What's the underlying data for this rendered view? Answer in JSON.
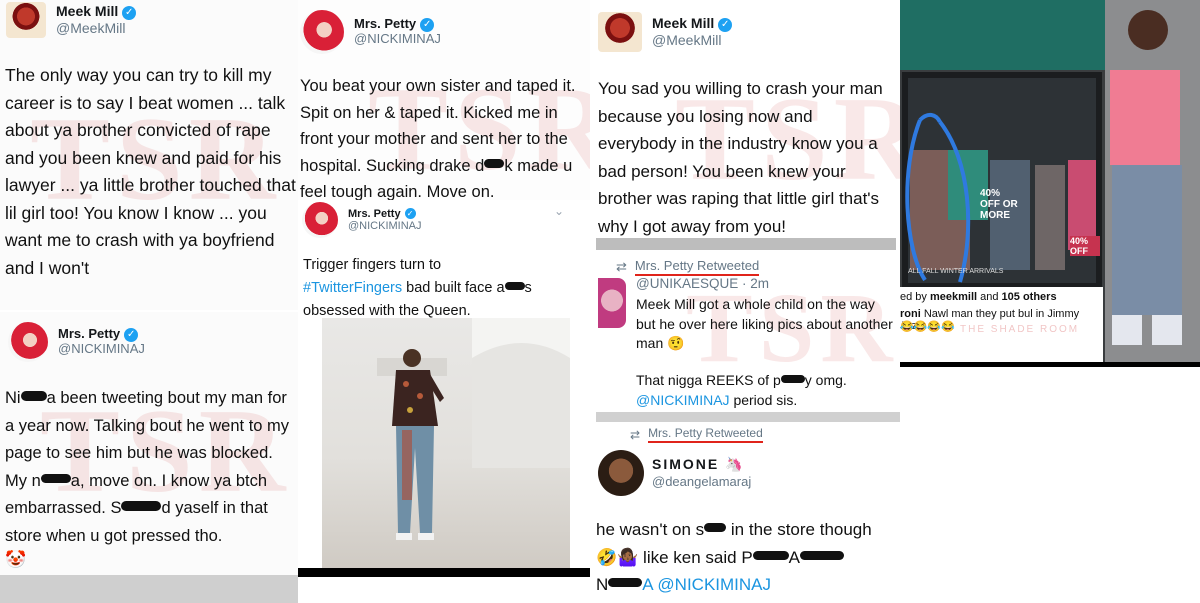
{
  "tweets": {
    "t1": {
      "name": "Meek Mill",
      "handle": "@MeekMill",
      "text": "The only way you can try to kill my career is to say I beat women ... talk about ya brother convicted of rape and you been knew and paid for his lawyer ... ya little brother touched that lil girl too! You know I know ... you want me to crash with ya boyfriend and I won't"
    },
    "t2": {
      "name": "Mrs. Petty",
      "handle": "@NICKIMINAJ",
      "text_a": "Ni",
      "text_b": "a been tweeting bout my man for a year now. Talking bout he went to my page to see him but he was blocked. My n",
      "text_c": "a, move on. I know ya btch embarrassed. S",
      "text_d": "d yaself in that store when u got pressed tho.",
      "emoji": "🤡"
    },
    "t3": {
      "name": "Mrs. Petty",
      "handle": "@NICKIMINAJ",
      "text_a": "You beat your own sister and taped it. Spit on her & taped it. Kicked me in front your mother and sent her to the hospital. Sucking drake d",
      "text_b": "k made u feel tough again. Move on."
    },
    "t4": {
      "name": "Mrs. Petty",
      "handle": "@NICKIMINAJ",
      "text_pre": "Trigger fingers turn to",
      "hashtag": "#TwitterFingers",
      "text_a": " bad built face a",
      "text_b": "s obsessed with the Queen."
    },
    "t5": {
      "name": "Meek Mill",
      "handle": "@MeekMill",
      "text": "You sad you willing to crash your man because you losing now and everybody in the industry know you a bad person! You been knew your brother was raping that little girl that's why I got away from you!"
    },
    "t6": {
      "retweeted": "Mrs. Petty Retweeted",
      "handle_time": "@UNIKAESQUE · 2m",
      "text1": "Meek Mill got a whole child on the way but he over here liking pics about another man 🤨",
      "text2a": "That nigga REEKS of p",
      "text2b": "y omg.",
      "mention": "@NICKIMINAJ",
      "text2c": " period sis."
    },
    "t7": {
      "retweeted": "Mrs. Petty Retweeted",
      "name": "SIMONE 🦄",
      "handle": "@deangelamaraj",
      "text_a": "he wasn't on s",
      "text_b": "in the store though",
      "line2a": "🤣🤷🏾‍♀️ like ken said P",
      "line2b": "A",
      "line3a": "N",
      "mention": "A @NICKIMINAJ"
    }
  },
  "watermark": {
    "letters": "TSR",
    "subtitle": "THE SHADE ROOM"
  },
  "instagram": {
    "likes_prefix": "ed by ",
    "likes_user": "meekmill",
    "likes_mid": " and ",
    "likes_count": "105 others",
    "comment_user": "roni",
    "comment_text": " Nawl man they put bul in Jimmy Jazz",
    "emojis": "😂😂😂😂"
  },
  "colors": {
    "verified": "#1da1f2",
    "mention": "#1b95e0",
    "underline": "#e0241b"
  },
  "store": {
    "sign": "40% OFF OR MORE",
    "sign2": "ALL FALL WINTER ARRIVALS",
    "sign3": "40% OFF"
  }
}
